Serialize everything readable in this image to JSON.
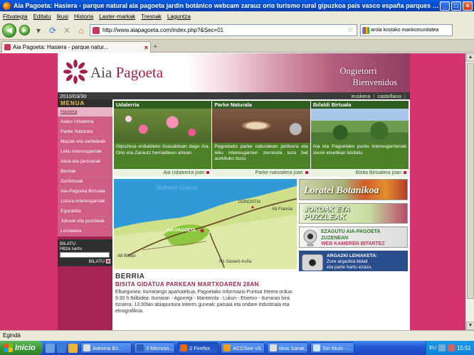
{
  "window": {
    "title": "Aia Pagoeta: Hasiera - parque natural aia pagoeta jardín botánico webcam zarauz orio turismo rural gipuzkoa país vasco españa parques naturales ...",
    "buttons": {
      "minimize": "_",
      "maximize": "□",
      "close": "×"
    }
  },
  "menubar": [
    "Fitxategia",
    "Editatu",
    "Ikusi",
    "Historia",
    "Laster-markak",
    "Tresnak",
    "Laguntza"
  ],
  "navbar": {
    "url": "http://www.aiapagoeta.com/index.php?&Sec=01",
    "search_value": "arola kostako mankomunitatea"
  },
  "tab": {
    "label": "Aia Pagoeta: Hasiera - parque natur..."
  },
  "site": {
    "logo_aia": "Aia",
    "logo_pagoeta": "Pagoeta",
    "greeting_line1": "Ongietorri",
    "greeting_line2": "Bienvenidos",
    "date": "2010/03/30",
    "langs": [
      "euskera",
      "castellano"
    ],
    "menu_title": "MENUA",
    "menu": [
      "Hasiera",
      "Aiako Udalerria",
      "Parke Naturala",
      "Mapak eta sarbideak",
      "Leku interesgarriak",
      "Aisia eta jarduerak",
      "Berriak",
      "Zerbitzuak",
      "Aia-Pagoeta Birtuala",
      "Lotura interesgarriak",
      "Eguraldia",
      "Jokoak eta puzzleak",
      "Lehiaketa"
    ],
    "search": {
      "label": "BILATU",
      "hint": "Hitza sartu",
      "button": "BILATU"
    },
    "columns": [
      {
        "title": "Udalerria",
        "text": "Gipuzkoa erdialdeko itsasaldean dago Aia, Orio eta Zarautz herrialdeen artean",
        "link": "Aia Udalerrira joan"
      },
      {
        "title": "Parke Naturala",
        "text": "Pagoetako parke naturalean jarduera eta leku interesgarrien zerrenda luza bat aurkituko duzu",
        "link": "Parke naturalera joan"
      },
      {
        "title": "Ibilaldi Birtuala",
        "text": "Aia eta Pagoetako puntu interesgarrienak zeure etxetikan bisitatu",
        "link": "Bisita Birtualera joan"
      }
    ],
    "map": {
      "sea": "Bizkaiko Golkoa",
      "donostia": "DONOSTIA",
      "aia": "AIA-PAGOETA",
      "a8_francia": "A8 Francia",
      "a8_bilbao": "A8 Bilbao",
      "n1": "N1 Gasteiz-Iruña"
    },
    "news": {
      "title": "BERRIA",
      "subtitle": "BISITA GIDATUA PARKEAN MARTXOAREN 28AN",
      "body": "Elkargunea: Iturrarango aparkalekua, Pagoetako Informazio Puntua Irteera ordua: 9:30 h Ibilbidea: Iturraran - Agorregi - Manterola - Lukun - Etxetxo - Iturraran bira. Itzulera: 13:30tan abiapuntura Interes guneak: paisaia eta ondare industriala eta etnografikoa."
    },
    "banners": {
      "loratei": "Loratei Botanikoa",
      "jokoak1": "JOKOAK ETA",
      "jokoak2": "PUZZLEAK",
      "ezagutu1": "EZAGUTU AIA-PAGOETA",
      "ezagutu2": "ZUZENEAN",
      "ezagutu3": "WEB KAMEREN BITARTEZ",
      "argazki_title": "ARGAZKI LEHIAKETA:",
      "argazki_l1": "Zure argazkia bidali",
      "argazki_l2": "eta parte hartu ezazu."
    }
  },
  "status": "Egindā",
  "taskbar": {
    "start": "Inicio",
    "tasks": [
      "Admina Bz...",
      "3 Microso...",
      "2 Firefox",
      "ACDSee v3...",
      "deia Sarak...",
      "Sin título -..."
    ],
    "lang": "EU",
    "time": "15:51"
  },
  "colors": {
    "page_bg": "#d4336e",
    "sidebar": "#a72353",
    "green": "#3d7a2a",
    "accent": "#a3214e"
  }
}
